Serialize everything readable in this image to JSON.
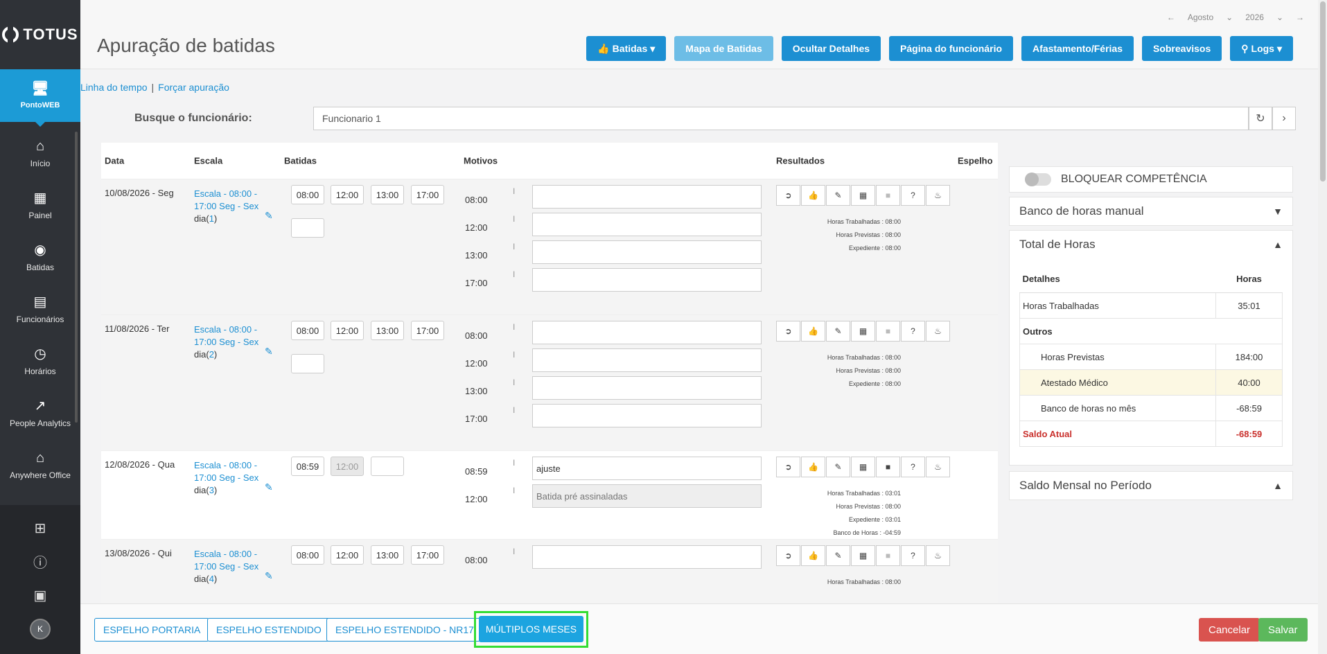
{
  "app": {
    "logo": "TOTUS"
  },
  "sidebar": {
    "active": {
      "label": "PontoWEB",
      "icon": "monitor-icon"
    },
    "items": [
      {
        "label": "Início",
        "icon": "home-icon"
      },
      {
        "label": "Painel",
        "icon": "dashboard-icon"
      },
      {
        "label": "Batidas",
        "icon": "fingerprint-icon"
      },
      {
        "label": "Funcionários",
        "icon": "badge-icon"
      },
      {
        "label": "Horários",
        "icon": "clock-icon"
      },
      {
        "label": "People Analytics",
        "icon": "trending-up-icon"
      },
      {
        "label": "Anywhere Office",
        "icon": "house-office-icon"
      }
    ],
    "bottom_icons": [
      "apps-grid-icon",
      "help-icon",
      "building-icon"
    ],
    "avatar": "K"
  },
  "header": {
    "title": "Apuração de batidas",
    "month": "Agosto",
    "year": "2026",
    "buttons": {
      "batidas": "Batidas",
      "mapa": "Mapa de Batidas",
      "ocultar": "Ocultar Detalhes",
      "pagina": "Página do funcionário",
      "afastamento": "Afastamento/Férias",
      "sobreavisos": "Sobreavisos",
      "logs": "Logs"
    }
  },
  "links": {
    "timeline": "Linha do tempo",
    "separator": "|",
    "force": "Forçar apuração"
  },
  "search": {
    "label": "Busque o funcionário:",
    "value": "Funcionario 1"
  },
  "table": {
    "headers": {
      "data": "Data",
      "escala": "Escala",
      "batidas": "Batidas",
      "motivos": "Motivos",
      "resultados": "Resultados",
      "espelho": "Espelho"
    },
    "rows": [
      {
        "date": "10/08/2026 - Seg",
        "escala": "Escala - 08:00 - 17:00 Seg - Sex",
        "dia_prefix": "dia(",
        "dia_num": "1",
        "dia_suffix": ")",
        "punches": [
          "08:00",
          "12:00",
          "13:00",
          "17:00",
          ""
        ],
        "motivos": [
          {
            "time": "08:00",
            "tick": "I",
            "value": ""
          },
          {
            "time": "12:00",
            "tick": "I",
            "value": ""
          },
          {
            "time": "13:00",
            "tick": "I",
            "value": ""
          },
          {
            "time": "17:00",
            "tick": "I",
            "value": ""
          }
        ],
        "results": [
          "Horas Trabalhadas : 08:00",
          "Horas Previstas : 08:00",
          "Expediente : 08:00"
        ]
      },
      {
        "date": "11/08/2026 - Ter",
        "escala": "Escala - 08:00 - 17:00 Seg - Sex",
        "dia_prefix": "dia(",
        "dia_num": "2",
        "dia_suffix": ")",
        "punches": [
          "08:00",
          "12:00",
          "13:00",
          "17:00",
          ""
        ],
        "motivos": [
          {
            "time": "08:00",
            "tick": "I",
            "value": ""
          },
          {
            "time": "12:00",
            "tick": "I",
            "value": ""
          },
          {
            "time": "13:00",
            "tick": "I",
            "value": ""
          },
          {
            "time": "17:00",
            "tick": "I",
            "value": ""
          }
        ],
        "results": [
          "Horas Trabalhadas : 08:00",
          "Horas Previstas : 08:00",
          "Expediente : 08:00"
        ]
      },
      {
        "date": "12/08/2026 - Qua",
        "escala": "Escala - 08:00 - 17:00 Seg - Sex",
        "dia_prefix": "dia(",
        "dia_num": "3",
        "dia_suffix": ")",
        "punches": [
          "08:59",
          "12:00",
          ""
        ],
        "motivos": [
          {
            "time": "08:59",
            "tick": "I",
            "value": "ajuste"
          },
          {
            "time": "12:00",
            "tick": "I",
            "placeholder": "Batida pré assinaladas"
          }
        ],
        "results": [
          "Horas Trabalhadas : 03:01",
          "Horas Previstas : 08:00",
          "Expediente : 03:01",
          "Banco de Horas : -04:59"
        ]
      },
      {
        "date": "13/08/2026 - Qui",
        "escala": "Escala - 08:00 - 17:00 Seg - Sex",
        "dia_prefix": "dia(",
        "dia_num": "4",
        "dia_suffix": ")",
        "punches": [
          "08:00",
          "12:00",
          "13:00",
          "17:00"
        ],
        "motivos": [
          {
            "time": "08:00",
            "tick": "I",
            "value": ""
          }
        ],
        "results": [
          "Horas Trabalhadas : 08:00"
        ]
      }
    ],
    "result_icons": [
      "exit-door-icon",
      "thumbs-up-icon",
      "pencil-icon",
      "calendar-icon",
      "comment-icon",
      "help-circle-icon",
      "bell-icon"
    ]
  },
  "right_panel": {
    "lock_label": "BLOQUEAR COMPETÊNCIA",
    "banco_manual": "Banco de horas manual",
    "total_horas": "Total de Horas",
    "totals_headers": {
      "detalhes": "Detalhes",
      "horas": "Horas"
    },
    "horas_trabalhadas": {
      "label": "Horas Trabalhadas",
      "value": "35:01"
    },
    "outros": "Outros",
    "horas_previstas": {
      "label": "Horas Previstas",
      "value": "184:00"
    },
    "atestado": {
      "label": "Atestado Médico",
      "value": "40:00"
    },
    "banco_mes": {
      "label": "Banco de horas no mês",
      "value": "-68:59"
    },
    "saldo_atual": {
      "label": "Saldo Atual",
      "value": "-68:59"
    },
    "saldo_mensal": "Saldo Mensal no Período"
  },
  "bottom": {
    "espelho_portaria": "ESPELHO PORTARIA",
    "espelho_estendido": "ESPELHO ESTENDIDO",
    "espelho_nr17": "ESPELHO ESTENDIDO - NR17",
    "multiplos": "MÚLTIPLOS MESES",
    "cancelar": "Cancelar",
    "salvar": "Salvar"
  },
  "colors": {
    "primary": "#1c8fd2",
    "sidebar": "#2f3237",
    "danger": "#d9534f",
    "success": "#5cb85c",
    "highlight": "#33dd33"
  }
}
